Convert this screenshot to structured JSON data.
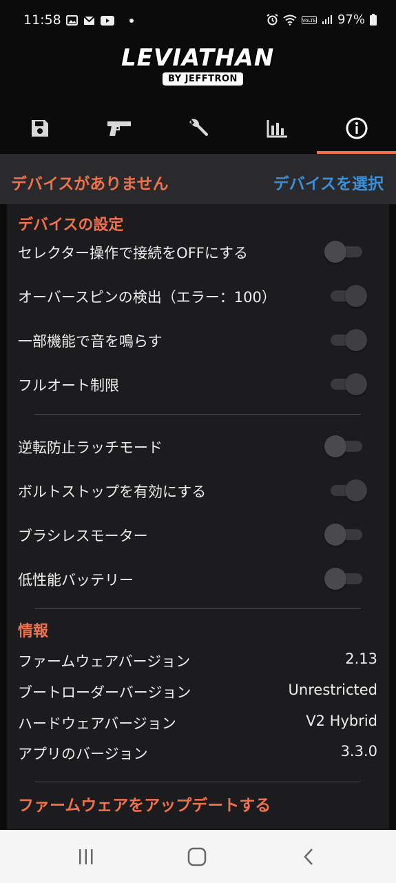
{
  "status_bar": {
    "time": "11:58",
    "battery": "97%",
    "icons_left": [
      "image-icon",
      "mail-icon",
      "youtube-icon",
      "dot-icon"
    ],
    "icons_right": [
      "alarm-icon",
      "wifi-icon",
      "volte-icon",
      "signal-icon",
      "battery-icon"
    ]
  },
  "logo": {
    "main": "LEVIATHAN",
    "sub": "BY JEFFTRON"
  },
  "tabs": [
    {
      "icon": "save-icon",
      "active": false
    },
    {
      "icon": "gun-icon",
      "active": false
    },
    {
      "icon": "wrench-icon",
      "active": false
    },
    {
      "icon": "bar-chart-icon",
      "active": false
    },
    {
      "icon": "info-icon",
      "active": true
    }
  ],
  "device": {
    "status": "デバイスがありません",
    "select_label": "デバイスを選択"
  },
  "settings": {
    "title": "デバイスの設定",
    "group1": [
      {
        "label": "セレクター操作で接続をOFFにする",
        "on": false
      },
      {
        "label": "オーバースピンの検出（エラー：100）",
        "on": true
      },
      {
        "label": "一部機能で音を鳴らす",
        "on": true
      },
      {
        "label": "フルオート制限",
        "on": true
      }
    ],
    "group2": [
      {
        "label": "逆転防止ラッチモード",
        "on": false
      },
      {
        "label": "ボルトストップを有効にする",
        "on": true
      },
      {
        "label": "ブラシレスモーター",
        "on": false
      },
      {
        "label": "低性能バッテリー",
        "on": false
      }
    ]
  },
  "info": {
    "title": "情報",
    "rows": [
      {
        "label": "ファームウェアバージョン",
        "value": "2.13"
      },
      {
        "label": "ブートローダーバージョン",
        "value": "Unrestricted"
      },
      {
        "label": "ハードウェアバージョン",
        "value": "V2 Hybrid"
      },
      {
        "label": "アプリのバージョン",
        "value": "3.3.0"
      }
    ]
  },
  "update_label": "ファームウェアをアップデートする",
  "nav": [
    "recents-icon",
    "home-icon",
    "back-icon"
  ],
  "colors": {
    "accent": "#f0714c",
    "link": "#3b8fd9",
    "panel": "#1c1c1e",
    "devicebar": "#2a2a2d"
  }
}
